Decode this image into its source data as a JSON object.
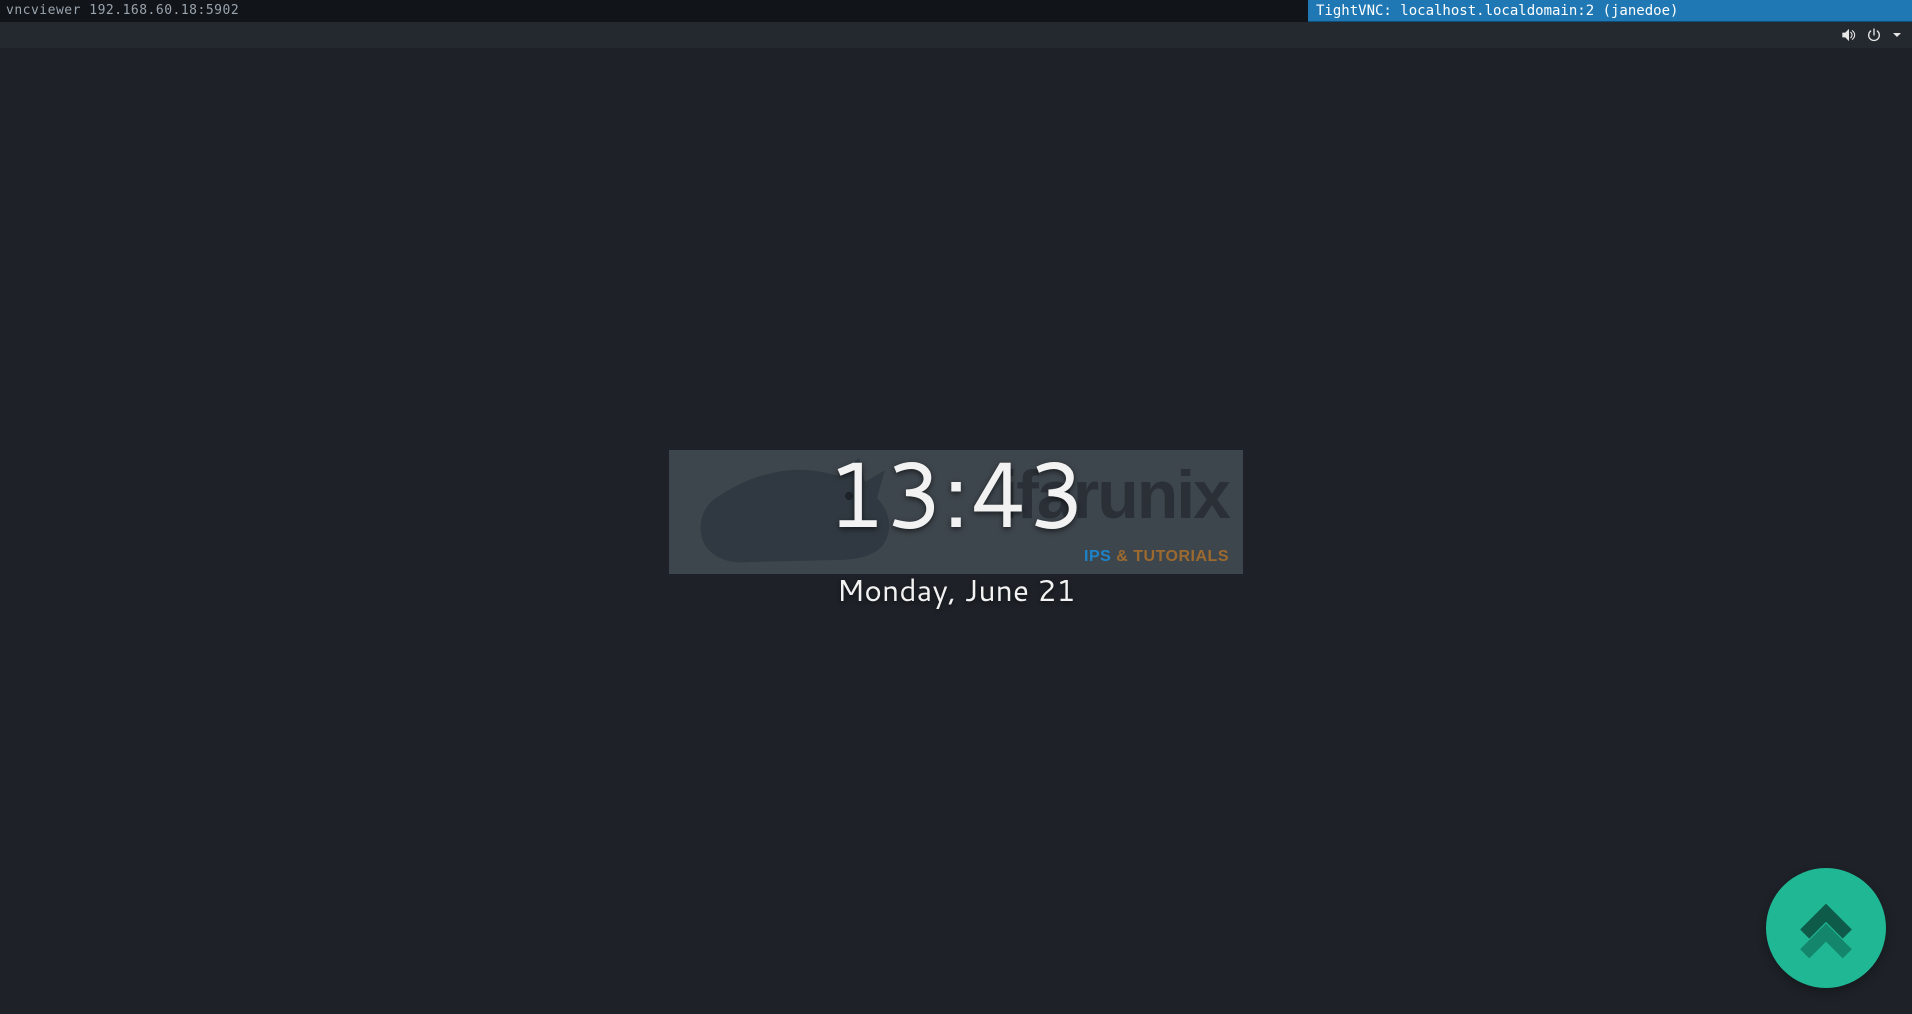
{
  "outer_window": {
    "left_title": "vncviewer 192.168.60.18:5902",
    "right_title": "TightVNC: localhost.localdomain:2 (janedoe)"
  },
  "panel": {
    "icons": {
      "volume": "volume-icon",
      "power": "power-icon",
      "caret": "caret-down-icon"
    }
  },
  "lockscreen": {
    "time": "13:43",
    "date": "Monday, June 21"
  },
  "watermark": {
    "brand": "ifarunix",
    "tagline_prefix": "IPS",
    "tagline_suffix": " & TUTORIALS"
  },
  "badge": {
    "name": "corner-up-chevron"
  }
}
